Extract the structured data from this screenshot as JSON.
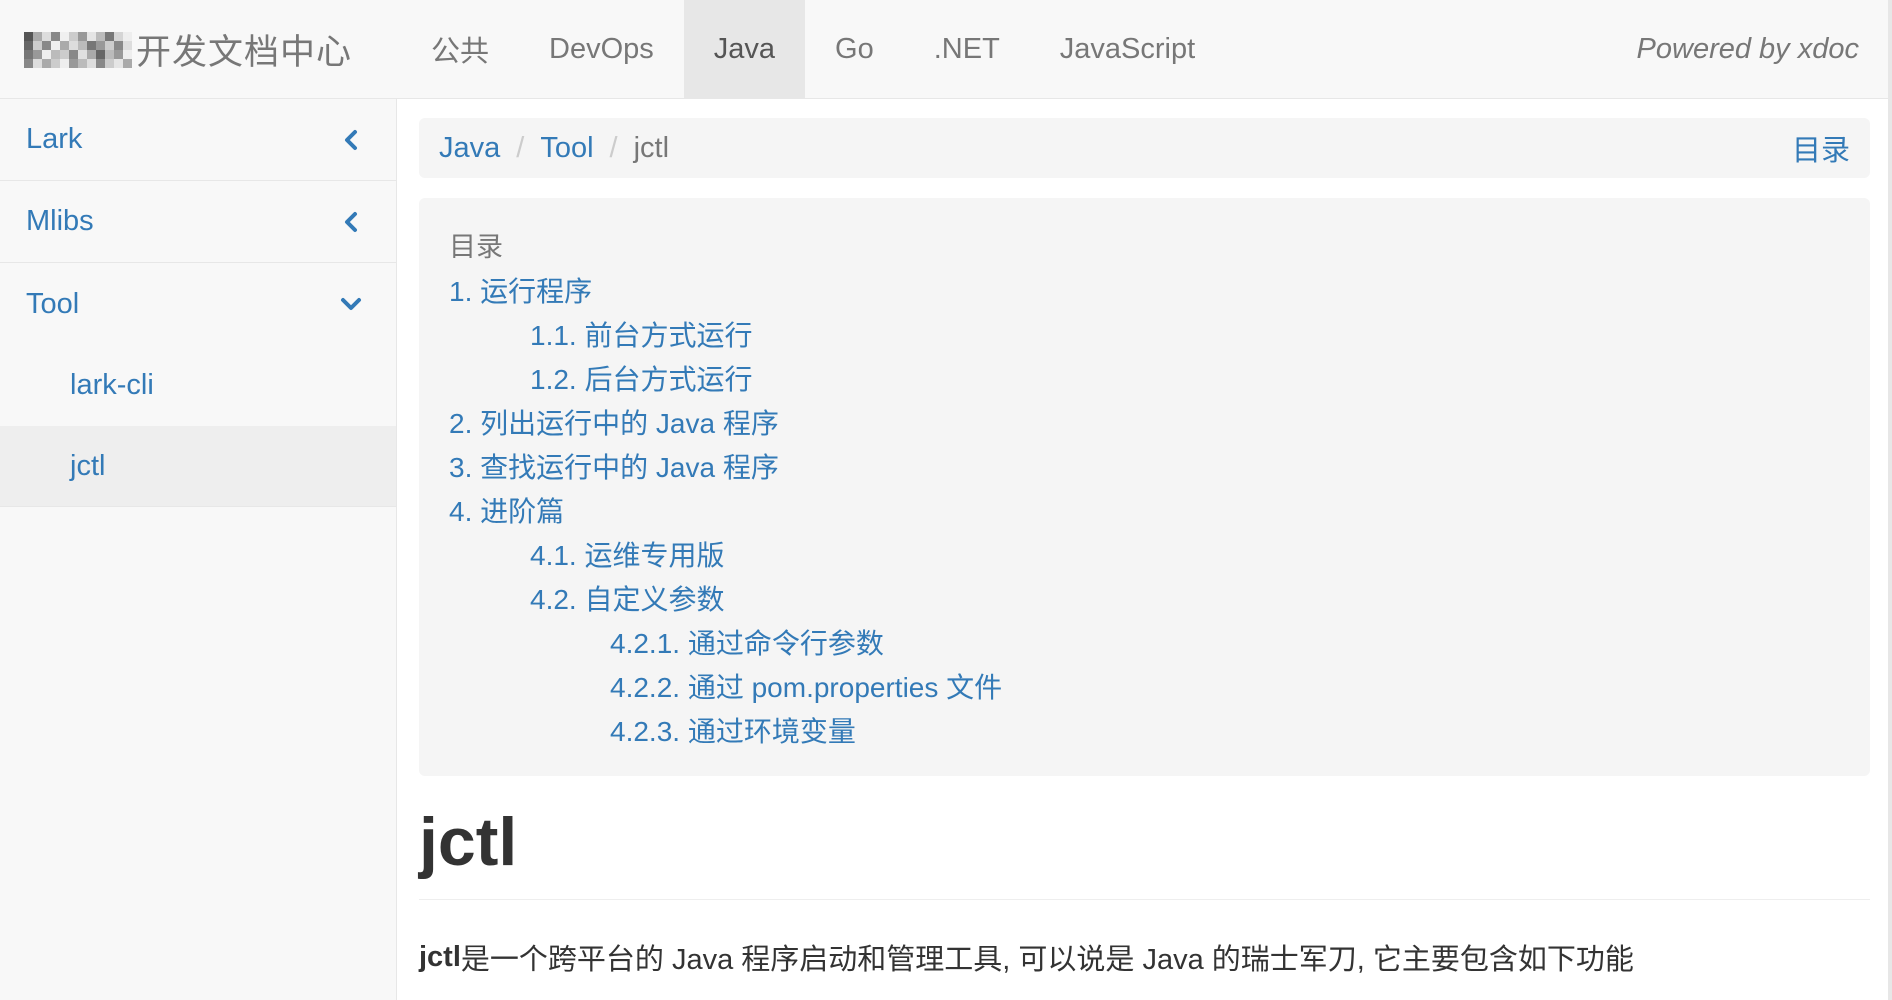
{
  "navbar": {
    "brand_text": "开发文档中心",
    "items": [
      {
        "label": "公共",
        "active": false
      },
      {
        "label": "DevOps",
        "active": false
      },
      {
        "label": "Java",
        "active": true
      },
      {
        "label": "Go",
        "active": false
      },
      {
        "label": ".NET",
        "active": false
      },
      {
        "label": "JavaScript",
        "active": false
      }
    ],
    "powered_by": "Powered by xdoc"
  },
  "sidebar": {
    "items": [
      {
        "label": "Lark",
        "icon": "chevron-left-icon"
      },
      {
        "label": "Mlibs",
        "icon": "chevron-left-icon"
      },
      {
        "label": "Tool",
        "icon": "chevron-down-icon"
      }
    ],
    "sub_items": [
      {
        "label": "lark-cli",
        "active": false
      },
      {
        "label": "jctl",
        "active": true
      }
    ]
  },
  "breadcrumb": {
    "items": [
      "Java",
      "Tool"
    ],
    "current": "jctl",
    "toc_link": "目录"
  },
  "toc": {
    "title": "目录",
    "entries": [
      {
        "text": "1. 运行程序",
        "level": 1
      },
      {
        "text": "1.1. 前台方式运行",
        "level": 2
      },
      {
        "text": "1.2. 后台方式运行",
        "level": 2
      },
      {
        "text": "2. 列出运行中的 Java 程序",
        "level": 1
      },
      {
        "text": "3. 查找运行中的 Java 程序",
        "level": 1
      },
      {
        "text": "4. 进阶篇",
        "level": 1
      },
      {
        "text": "4.1. 运维专用版",
        "level": 2
      },
      {
        "text": "4.2. 自定义参数",
        "level": 2
      },
      {
        "text": "4.2.1. 通过命令行参数",
        "level": 3
      },
      {
        "text": "4.2.2. 通过 pom.properties 文件",
        "level": 3
      },
      {
        "text": "4.2.3. 通过环境变量",
        "level": 3
      }
    ]
  },
  "content": {
    "title": "jctl",
    "intro_bold": "jctl",
    "intro_rest": " 是一个跨平台的 Java 程序启动和管理工具, 可以说是 Java 的瑞士军刀, 它主要包含如下功能"
  },
  "colors": {
    "link": "#337ab7",
    "muted": "#777777",
    "navbar_bg": "#f8f8f8",
    "active_bg": "#e7e7e7",
    "panel_bg": "#f5f5f5"
  }
}
